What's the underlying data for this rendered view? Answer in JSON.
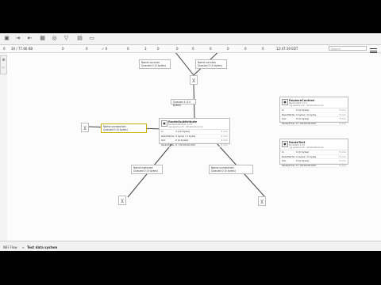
{
  "toolbar": {
    "icons": [
      "processor-icon",
      "input-port-icon",
      "output-port-icon",
      "process-group-icon",
      "remote-group-icon",
      "funnel-icon",
      "template-icon",
      "label-icon"
    ]
  },
  "status": {
    "items": [
      "0",
      "30 / 77.66 KB",
      "0",
      "0",
      "✓ 0",
      "0",
      "3",
      "0",
      "0",
      "0",
      "0",
      "0",
      "0",
      "0",
      "12:47:19 EDT"
    ],
    "search_placeholder": "Search"
  },
  "side": {
    "icons": [
      "navigate-icon",
      "operate-icon"
    ]
  },
  "connections": {
    "top_left": {
      "name": "Name success",
      "queue": "Queued 0 (0 bytes)"
    },
    "top_right": {
      "name": "Name success",
      "queue": "Queued 0 (0 bytes)"
    },
    "center": {
      "queue": "Queued 4 (10 bytes)"
    },
    "left": {
      "name": "Name unmatched",
      "queue": "Queued 0 (0 bytes)"
    },
    "bottom_left": {
      "name": "Name matched",
      "queue": "Queued 0 (0 bytes)"
    },
    "bottom_right": {
      "name": "Name unmatched",
      "queue": "Queued 0 (0 bytes)"
    }
  },
  "processors": {
    "main": {
      "name": "RouteOnAttribute",
      "type": "RouteOnAttribute 1.2.0",
      "bundle": "org.apache.nifi - nifi-standard-nar",
      "rows": [
        {
          "k": "In",
          "v": "4 (10 bytes)",
          "t": "5 min"
        },
        {
          "k": "Read/Write",
          "v": "0 bytes / 0 bytes",
          "t": "5 min"
        },
        {
          "k": "Out",
          "v": "0 (0 bytes)",
          "t": "5 min"
        },
        {
          "k": "Tasks/Time",
          "v": "0 / 00:00:00.000",
          "t": "5 min"
        }
      ]
    },
    "right1": {
      "name": "ReplaceContent",
      "type": "ReplaceText 1.2.0",
      "bundle": "org.apache.nifi - nifi-standard-nar",
      "rows": [
        {
          "k": "In",
          "v": "0 (0 bytes)",
          "t": "5 min"
        },
        {
          "k": "Read/Write",
          "v": "0 bytes / 0 bytes",
          "t": "5 min"
        },
        {
          "k": "Out",
          "v": "0 (0 bytes)",
          "t": "5 min"
        },
        {
          "k": "Tasks/Time",
          "v": "0 / 00:00:00.000",
          "t": "5 min"
        }
      ]
    },
    "right2": {
      "name": "RouteText",
      "type": "RouteText 1.2.0",
      "bundle": "org.apache.nifi - nifi-standard-nar",
      "rows": [
        {
          "k": "In",
          "v": "0 (0 bytes)",
          "t": "5 min"
        },
        {
          "k": "Read/Write",
          "v": "0 bytes / 0 bytes",
          "t": "5 min"
        },
        {
          "k": "Out",
          "v": "0 (0 bytes)",
          "t": "5 min"
        },
        {
          "k": "Tasks/Time",
          "v": "0 / 00:00:00.000",
          "t": "5 min"
        }
      ]
    }
  },
  "footer": {
    "root": "NiFi Flow",
    "sep": "»",
    "group": "Test data system"
  }
}
